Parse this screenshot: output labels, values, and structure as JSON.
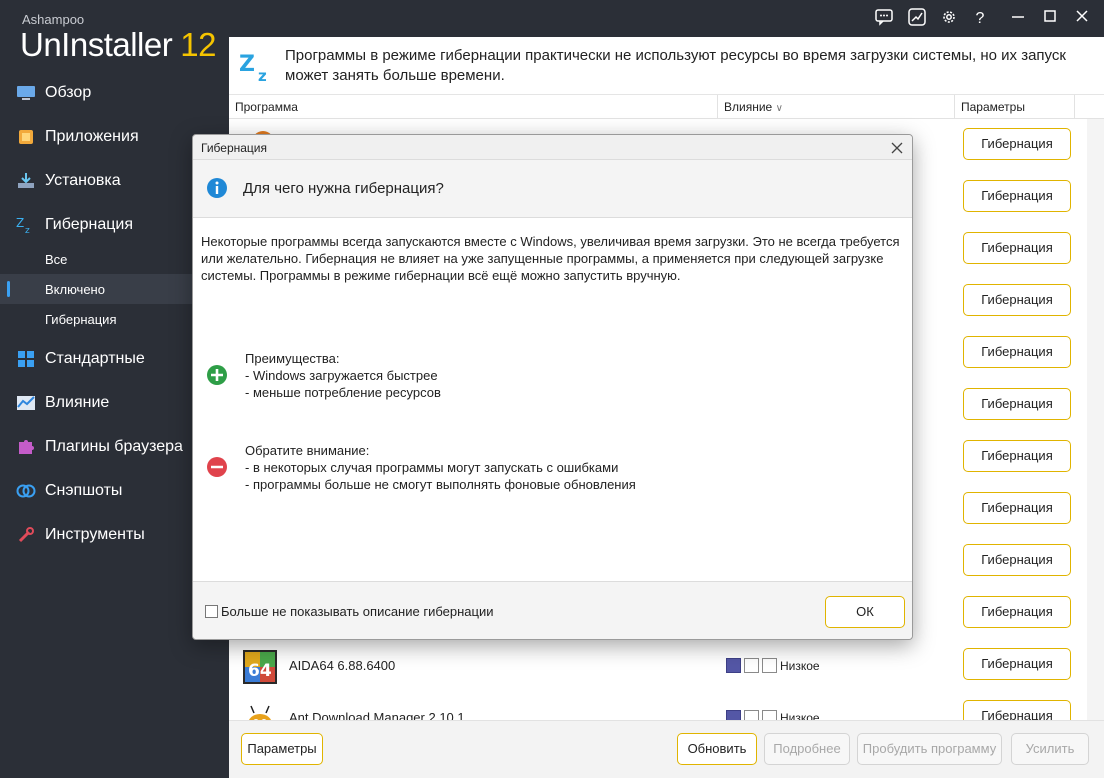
{
  "app": {
    "brand_small": "Ashampoo",
    "brand_name": "UnInstaller",
    "brand_version": "12"
  },
  "sidebar": {
    "items": [
      {
        "label": "Обзор",
        "icon": "monitor-icon"
      },
      {
        "label": "Приложения",
        "icon": "apps-icon"
      },
      {
        "label": "Установка",
        "icon": "install-icon"
      },
      {
        "label": "Гибернация",
        "icon": "zz-icon"
      }
    ],
    "subitems": [
      {
        "label": "Все"
      },
      {
        "label": "Включено"
      },
      {
        "label": "Гибернация"
      }
    ],
    "items2": [
      {
        "label": "Стандартные",
        "icon": "windows-icon"
      },
      {
        "label": "Влияние",
        "icon": "chart-icon"
      },
      {
        "label": "Плагины браузера",
        "icon": "puzzle-icon"
      },
      {
        "label": "Снэпшоты",
        "icon": "snapshot-icon"
      },
      {
        "label": "Инструменты",
        "icon": "tools-icon"
      }
    ]
  },
  "banner": {
    "text": "Программы в режиме гибернации практически не используют ресурсы во время загрузки системы, но их запуск может занять больше времени."
  },
  "columns": {
    "program": "Программа",
    "impact": "Влияние",
    "params": "Параметры"
  },
  "rows": [
    {
      "name": "",
      "impact": "",
      "button": "Гибернация"
    },
    {
      "name": "",
      "impact": "",
      "button": "Гибернация"
    },
    {
      "name": "",
      "impact": "",
      "button": "Гибернация"
    },
    {
      "name": "",
      "impact": "",
      "button": "Гибернация"
    },
    {
      "name": "",
      "impact": "",
      "button": "Гибернация"
    },
    {
      "name": "",
      "impact": "",
      "button": "Гибернация"
    },
    {
      "name": "",
      "impact": "",
      "button": "Гибернация"
    },
    {
      "name": "",
      "impact": "",
      "button": "Гибернация"
    },
    {
      "name": "",
      "impact": "",
      "button": "Гибернация"
    },
    {
      "name": "",
      "impact": "",
      "button": "Гибернация"
    },
    {
      "name": "AIDA64 6.88.6400",
      "impact": "Низкое",
      "button": "Гибернация"
    },
    {
      "name": "Ant Download Manager 2.10.1",
      "impact": "Низкое",
      "button": "Гибернация"
    }
  ],
  "bottom": {
    "settings": "Параметры",
    "refresh": "Обновить",
    "details": "Подробнее",
    "wake": "Пробудить программу",
    "delete": "Усилить"
  },
  "dialog": {
    "title": "Гибернация",
    "heading": "Для чего нужна гибернация?",
    "body": "Некоторые программы всегда запускаются вместе с Windows, увеличивая время загрузки. Это не всегда требуется или желательно. Гибернация не влияет на уже запущенные программы, а применяется при следующей загрузке системы. Программы в режиме гибернации всё ещё можно запустить вручную.",
    "pros_title": "Преимущества:",
    "pros": [
      "- Windows загружается быстрее",
      "- меньше потребление ресурсов"
    ],
    "cons_title": "Обратите внимание:",
    "cons": [
      "- в некоторых случая программы могут запускать с ошибками",
      "- программы больше не смогут выполнять фоновые обновления"
    ],
    "checkbox": "Больше не показывать описание гибернации",
    "ok": "ОК"
  }
}
